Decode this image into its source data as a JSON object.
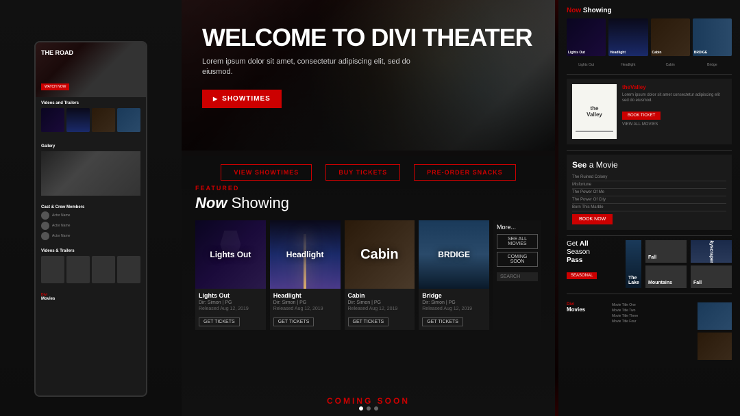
{
  "app": {
    "title": "Divi Theater"
  },
  "hero": {
    "title": "WELCOME TO DIVI THEATER",
    "subtitle": "Lorem ipsum dolor sit amet, consectetur adipiscing elit, sed do eiusmod.",
    "cta_label": "SHOWTIMES",
    "featured_label": "FEATURED",
    "now_showing": "Now Showing"
  },
  "mobile": {
    "the_road": "THE ROAD",
    "cta": "WATCH NOW",
    "videos_trailers": "Videos and Trailers",
    "gallery": "Gallery",
    "cast_crew": "Cast & Crew Members",
    "videos_trailers2": "Videos & Trailers",
    "divi_label": "Divi",
    "movies_label": "Movies"
  },
  "action_buttons": {
    "view_showtimes": "VIEW SHOWTIMES",
    "buy_tickets": "BUY TICKETS",
    "pre_order_snacks": "PRE-ORDER SNACKS"
  },
  "movies": [
    {
      "title": "Lights Out",
      "director": "Dir: Simon | PG",
      "released": "Released Aug 12, 2019",
      "poster_class": "poster-lights-out",
      "poster_text": "Lights Out",
      "text_size": ""
    },
    {
      "title": "Headlight",
      "director": "Dir: Simon | PG",
      "released": "Released Aug 12, 2019",
      "poster_class": "poster-headlight",
      "poster_text": "Headlight",
      "text_size": ""
    },
    {
      "title": "Cabin",
      "director": "Dir: Simon | PG",
      "released": "Released Aug 12, 2019",
      "poster_class": "poster-cabin",
      "poster_text": "Cabin",
      "text_size": "large"
    },
    {
      "title": "Bridge",
      "director": "Dir: Simon | PG",
      "released": "Released Aug 12, 2019",
      "poster_class": "poster-bridge",
      "poster_text": "BRDIGE",
      "text_size": ""
    }
  ],
  "more_panel": {
    "label": "More...",
    "see_all": "SEE ALL MOVIES",
    "coming_soon": "COMING SOON",
    "search_placeholder": "SEARCH"
  },
  "right": {
    "now_showing_label": "Now Showing",
    "now_label": "Now",
    "the_valley": {
      "title": "theValley",
      "description": "Lorem ipsum dolor sit amet consectetur adipiscing elit sed do eiusmod.",
      "cta": "BOOK TICKET",
      "view_all": "VIEW ALL MOVIES"
    },
    "see_movie": {
      "title": "See a Movie",
      "items": [
        "The Ruined Colony",
        "Misfortune",
        "The Power Of Me",
        "The Power Of City",
        "Born This Marble"
      ],
      "cta": "BOOK NOW"
    },
    "season_pass": {
      "title": "Get All Season Pass",
      "badge": "SEASONAL"
    },
    "season_movies": [
      "The Lake",
      "Fall",
      "Skyscrapers",
      "Mountains",
      "Fall"
    ],
    "divi_movies": {
      "label": "Divi",
      "title": "Movies"
    }
  },
  "coming_soon": "COMING SOON",
  "colors": {
    "accent": "#cc0000",
    "bg_dark": "#0d0d0d",
    "text_primary": "#ffffff",
    "text_secondary": "#888888"
  }
}
